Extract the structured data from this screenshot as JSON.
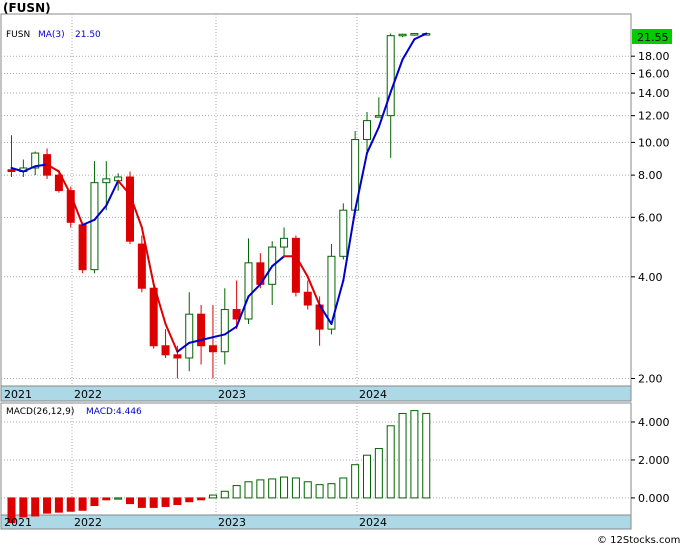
{
  "chart_data": [
    {
      "type": "candlestick",
      "title": "(FUSN)",
      "legend": {
        "symbol": "FUSN",
        "ma_label": "MA(3)",
        "ma_value": "21.50"
      },
      "last_price_label": "21.55",
      "colors": {
        "up": "#006400",
        "down": "#dd0000",
        "ma": "#0000cc",
        "ma_down": "#dd0000",
        "axis_band": "#add8e6",
        "price_tag": "#00cc00"
      },
      "y_scale": "log",
      "ylim": [
        1.9,
        24
      ],
      "ytick_labels": [
        "2.00",
        "4.00",
        "6.00",
        "8.00",
        "10.00",
        "12.00",
        "14.00",
        "16.00",
        "18.00"
      ],
      "yticks": [
        2,
        4,
        6,
        8,
        10,
        12,
        14,
        16,
        18
      ],
      "x_labels": [
        "2021",
        "2022",
        "2023",
        "2024"
      ],
      "x_label_month_index": [
        0,
        7,
        17,
        27
      ],
      "candles": [
        {
          "o": 8.3,
          "h": 10.5,
          "l": 7.9,
          "c": 8.2
        },
        {
          "o": 8.2,
          "h": 8.9,
          "l": 7.9,
          "c": 8.4
        },
        {
          "o": 8.4,
          "h": 9.4,
          "l": 8.0,
          "c": 9.3
        },
        {
          "o": 9.2,
          "h": 9.6,
          "l": 7.8,
          "c": 8.0
        },
        {
          "o": 8.0,
          "h": 8.3,
          "l": 7.1,
          "c": 7.2
        },
        {
          "o": 7.2,
          "h": 7.4,
          "l": 5.6,
          "c": 5.8
        },
        {
          "o": 5.7,
          "h": 5.8,
          "l": 4.1,
          "c": 4.2
        },
        {
          "o": 4.2,
          "h": 8.8,
          "l": 4.1,
          "c": 7.6
        },
        {
          "o": 7.6,
          "h": 8.8,
          "l": 6.3,
          "c": 7.8
        },
        {
          "o": 7.7,
          "h": 8.1,
          "l": 7.2,
          "c": 7.9
        },
        {
          "o": 7.9,
          "h": 8.2,
          "l": 5.0,
          "c": 5.1
        },
        {
          "o": 5.0,
          "h": 5.3,
          "l": 3.6,
          "c": 3.7
        },
        {
          "o": 3.7,
          "h": 3.8,
          "l": 2.45,
          "c": 2.5
        },
        {
          "o": 2.5,
          "h": 2.8,
          "l": 2.3,
          "c": 2.35
        },
        {
          "o": 2.35,
          "h": 2.5,
          "l": 2.0,
          "c": 2.3
        },
        {
          "o": 2.3,
          "h": 3.6,
          "l": 2.1,
          "c": 3.1
        },
        {
          "o": 3.1,
          "h": 3.3,
          "l": 2.2,
          "c": 2.5
        },
        {
          "o": 2.5,
          "h": 3.3,
          "l": 2.0,
          "c": 2.4
        },
        {
          "o": 2.4,
          "h": 3.7,
          "l": 2.2,
          "c": 3.2
        },
        {
          "o": 3.2,
          "h": 3.9,
          "l": 2.8,
          "c": 3.0
        },
        {
          "o": 3.0,
          "h": 5.2,
          "l": 2.9,
          "c": 4.4
        },
        {
          "o": 4.4,
          "h": 4.7,
          "l": 3.7,
          "c": 3.8
        },
        {
          "o": 3.8,
          "h": 5.1,
          "l": 3.3,
          "c": 4.9
        },
        {
          "o": 4.9,
          "h": 5.6,
          "l": 4.6,
          "c": 5.2
        },
        {
          "o": 5.2,
          "h": 5.3,
          "l": 3.5,
          "c": 3.6
        },
        {
          "o": 3.6,
          "h": 3.9,
          "l": 3.2,
          "c": 3.3
        },
        {
          "o": 3.3,
          "h": 3.5,
          "l": 2.5,
          "c": 2.8
        },
        {
          "o": 2.8,
          "h": 5.0,
          "l": 2.7,
          "c": 4.6
        },
        {
          "o": 4.6,
          "h": 6.6,
          "l": 4.5,
          "c": 6.3
        },
        {
          "o": 6.3,
          "h": 10.8,
          "l": 6.1,
          "c": 10.2
        },
        {
          "o": 10.2,
          "h": 12.3,
          "l": 9.3,
          "c": 11.6
        },
        {
          "o": 12.0,
          "h": 13.6,
          "l": 11.9,
          "c": 12.0
        },
        {
          "o": 12.0,
          "h": 21.0,
          "l": 9.0,
          "c": 20.7
        },
        {
          "o": 20.8,
          "h": 21.0,
          "l": 20.5,
          "c": 20.9
        },
        {
          "o": 20.9,
          "h": 21.0,
          "l": 20.7,
          "c": 21.0
        },
        {
          "o": 20.9,
          "h": 21.1,
          "l": 20.8,
          "c": 21.0
        }
      ],
      "ma3": [
        8.4,
        8.2,
        8.5,
        8.6,
        8.2,
        7.0,
        5.7,
        5.9,
        6.5,
        7.7,
        7.0,
        5.6,
        3.8,
        2.9,
        2.4,
        2.55,
        2.6,
        2.65,
        2.7,
        2.85,
        3.5,
        3.8,
        4.3,
        4.6,
        4.6,
        4.0,
        3.3,
        2.9,
        3.9,
        6.3,
        9.3,
        11.1,
        14.1,
        17.6,
        20.2,
        21.0
      ],
      "ma3_up": [
        false,
        true,
        true,
        true,
        false,
        false,
        false,
        true,
        true,
        true,
        false,
        false,
        false,
        false,
        false,
        true,
        true,
        true,
        true,
        true,
        true,
        true,
        true,
        true,
        false,
        false,
        false,
        true,
        true,
        true,
        true,
        true,
        true,
        true,
        true,
        true
      ]
    },
    {
      "type": "bar",
      "title": "MACD(26,12,9)",
      "legend_label": "MACD:4.446",
      "ylim": [
        -0.9,
        5.0
      ],
      "ytick_labels": [
        "0.000",
        "2.000",
        "4.000"
      ],
      "yticks": [
        0,
        2,
        4
      ],
      "x_labels": [
        "2021",
        "2022",
        "2023",
        "2024"
      ],
      "values": [
        -1.3,
        -1.0,
        -0.95,
        -0.8,
        -0.75,
        -0.7,
        -0.65,
        -0.4,
        -0.1,
        0.0,
        -0.3,
        -0.5,
        -0.5,
        -0.45,
        -0.35,
        -0.2,
        -0.1,
        0.15,
        0.35,
        0.65,
        0.85,
        0.95,
        1.0,
        1.1,
        1.05,
        0.85,
        0.7,
        0.75,
        1.05,
        1.75,
        2.25,
        2.6,
        3.8,
        4.45,
        4.6,
        4.45
      ]
    }
  ],
  "footer": "© 12Stocks.com"
}
